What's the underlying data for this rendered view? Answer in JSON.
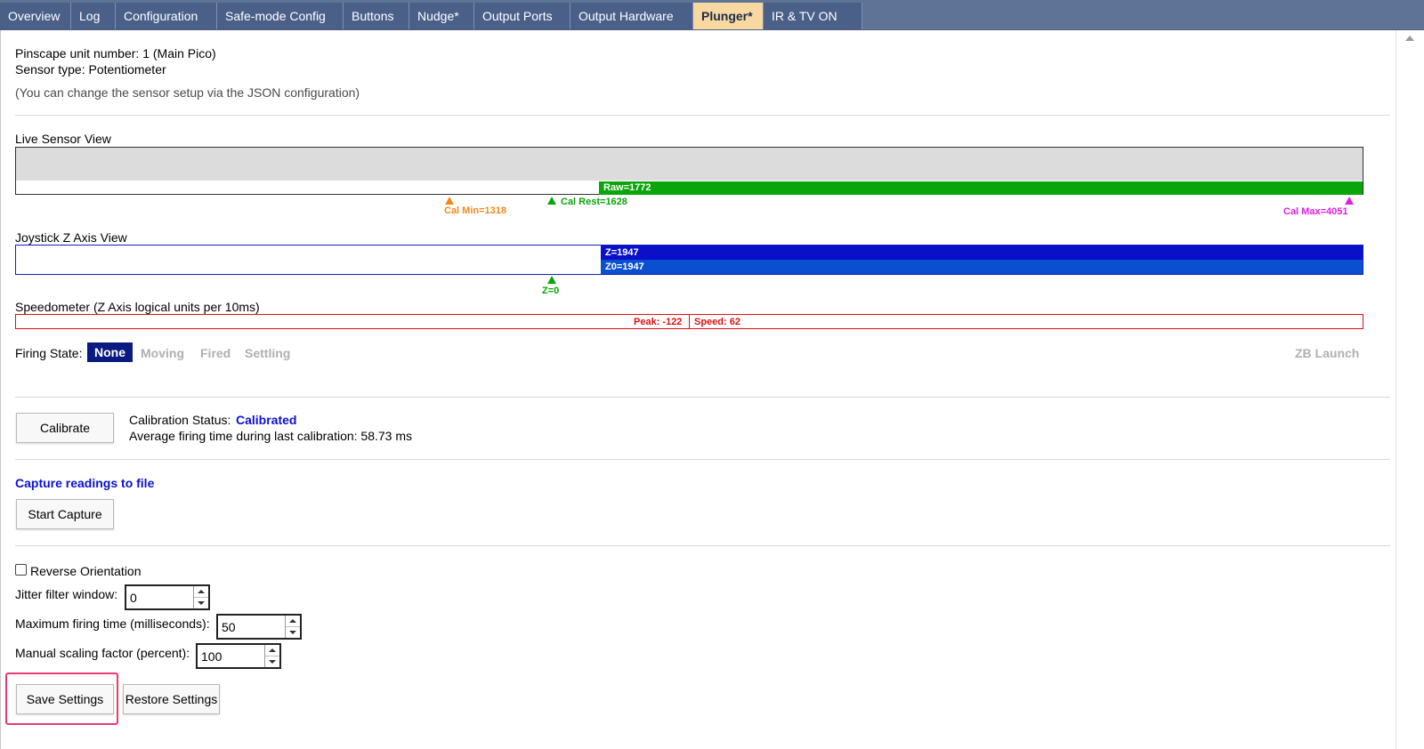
{
  "tabs": [
    {
      "label": "Overview",
      "active": false
    },
    {
      "label": "Log",
      "active": false
    },
    {
      "label": "Configuration",
      "active": false
    },
    {
      "label": "Safe-mode Config",
      "active": false
    },
    {
      "label": "Buttons",
      "active": false
    },
    {
      "label": "Nudge*",
      "active": false
    },
    {
      "label": "Output Ports",
      "active": false
    },
    {
      "label": "Output Hardware",
      "active": false
    },
    {
      "label": "Plunger*",
      "active": true
    },
    {
      "label": "IR & TV ON",
      "active": false
    }
  ],
  "info": {
    "unit_line": "Pinscape unit number: 1 (Main Pico)",
    "sensor_line": "Sensor type: Potentiometer",
    "note": "(You can change the sensor setup via the JSON configuration)"
  },
  "live_sensor": {
    "title": "Live Sensor View",
    "raw_label": "Raw=1772",
    "raw_value": 1772,
    "range_max": 4095,
    "cal_min_label": "Cal Min=1318",
    "cal_rest_label": "Cal Rest=1628",
    "cal_max_label": "Cal Max=4051",
    "colors": {
      "raw": "#0aa50a",
      "cal_min": "#f08a1a",
      "cal_rest": "#0aa50a",
      "cal_max": "#e020e0"
    }
  },
  "joystick": {
    "title": "Joystick Z Axis View",
    "z_label": "Z=1947",
    "z0_label": "Z0=1947",
    "zero_label": "Z=0",
    "colors": {
      "z": "#0a10c8",
      "z0": "#0a4fd0",
      "zero": "#0aa50a"
    }
  },
  "speedometer": {
    "title": "Speedometer (Z Axis logical units per 10ms)",
    "peak_label": "Peak: -122",
    "speed_label": "Speed: 62",
    "color": "#e01010"
  },
  "firing_state": {
    "label": "Firing State:",
    "states": [
      "None",
      "Moving",
      "Fired",
      "Settling"
    ],
    "active": "None",
    "zb_launch": "ZB Launch",
    "active_color": "#0a1a80"
  },
  "calibration": {
    "button": "Calibrate",
    "status_label": "Calibration Status:",
    "status_value": "Calibrated",
    "avg_line": "Average firing time during last calibration: 58.73 ms"
  },
  "capture": {
    "title": "Capture readings to file",
    "button": "Start Capture"
  },
  "settings": {
    "reverse_label": "Reverse Orientation",
    "reverse_checked": false,
    "jitter_label": "Jitter filter window:",
    "jitter_value": "0",
    "max_fire_label": "Maximum firing time (milliseconds):",
    "max_fire_value": "50",
    "scaling_label": "Manual scaling factor (percent):",
    "scaling_value": "100",
    "save_button": "Save Settings",
    "restore_button": "Restore Settings"
  }
}
